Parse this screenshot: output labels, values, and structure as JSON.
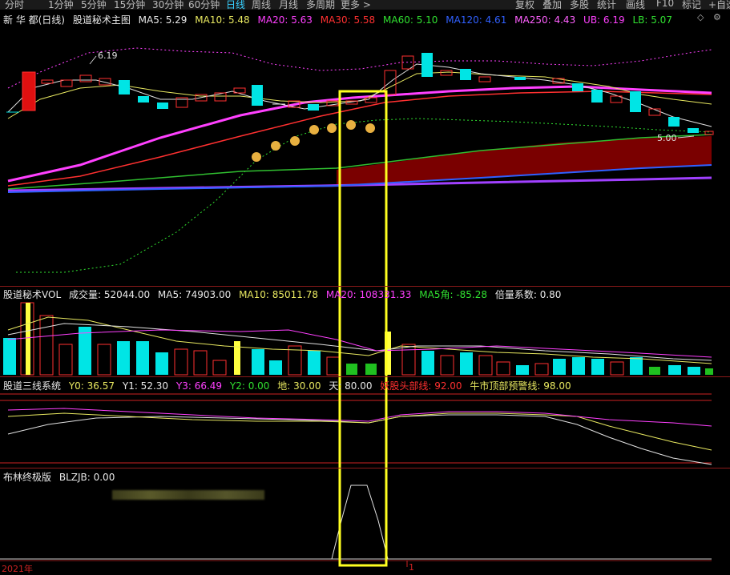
{
  "toolbar": {
    "tabs": [
      "分时",
      "1分钟",
      "5分钟",
      "15分钟",
      "30分钟",
      "60分钟",
      "日线",
      "周线",
      "月线",
      "多周期",
      "更多 >"
    ],
    "active": "日线",
    "right_buttons": [
      "复权",
      "叠加",
      "多股",
      "统计",
      "画线",
      "F10",
      "标记",
      "+自选"
    ]
  },
  "main": {
    "stock": "新 华 都(日线)",
    "indicator": "股道秘术主图",
    "ma5": "MA5: 5.29",
    "ma10": "MA10: 5.48",
    "ma20": "MA20: 5.63",
    "ma30": "MA30: 5.58",
    "ma60": "MA60: 5.10",
    "ma120": "MA120: 4.61",
    "ma250": "MA250: 4.43",
    "ub": "UB: 6.19",
    "lb": "LB: 5.07",
    "high_label": "6.19",
    "low_label": "5.00",
    "colors": {
      "ma5": "#e8e8e8",
      "ma10": "#e8e860",
      "ma20": "#ff40ff",
      "ma30": "#ff3030",
      "ma60": "#30e030",
      "ma120": "#3060ff",
      "ma250": "#ff60ff",
      "ub": "#ff40ff",
      "lb": "#30e030"
    }
  },
  "vol": {
    "indicator": "股道秘术VOL",
    "volume": "成交量: 52044.00",
    "ma5": "MA5: 74903.00",
    "ma10": "MA10: 85011.78",
    "ma20": "MA20: 108331.33",
    "ma5angle": "MA5角: -85.28",
    "ratio": "倍量系数: 0.80"
  },
  "three": {
    "indicator": "股道三线系统",
    "y0": "Y0: 36.57",
    "y1": "Y1: 52.30",
    "y3": "Y3: 66.49",
    "y2": "Y2: 0.00",
    "di": "地: 30.00",
    "tian": "天: 80.00",
    "yao": "妖股头部线: 92.00",
    "niu": "牛市顶部预警线: 98.00"
  },
  "boll": {
    "indicator": "布林终极版",
    "blzjb": "BLZJB: 0.00"
  },
  "axis": {
    "year": "2021年",
    "month": "1"
  }
}
